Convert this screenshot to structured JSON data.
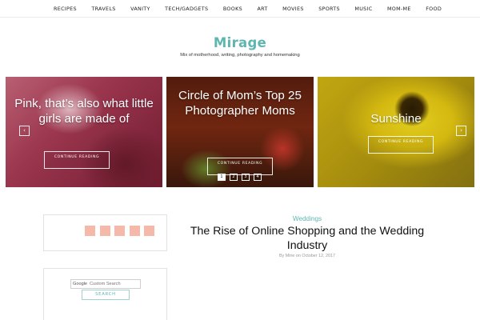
{
  "nav": {
    "items": [
      "RECIPES",
      "TRAVELS",
      "VANITY",
      "TECH/GADGETS",
      "BOOKS",
      "ART",
      "MOVIES",
      "SPORTS",
      "MUSIC",
      "MOM-ME",
      "FOOD"
    ]
  },
  "site": {
    "title": "Mirage",
    "tagline": "Mix of motherhood, writing, photography and homemaking"
  },
  "slider": {
    "slides": [
      {
        "title": "Pink, that’s also what little girls are made of",
        "button": "CONTINUE READING"
      },
      {
        "title": "Circle of Mom’s Top 25 Photographer Moms",
        "button": "CONTINUE READING"
      },
      {
        "title": "Sunshine",
        "button": "CONTINUE READING"
      }
    ],
    "prev_arrow": "‹",
    "next_arrow": "›",
    "pages": [
      "1",
      "2",
      "3",
      "4"
    ],
    "active_page": "1"
  },
  "sidebar": {
    "social_icon_count": 5,
    "social_color": "#f5b9aa",
    "search": {
      "google_label": "Google",
      "placeholder": "Custom Search",
      "button": "SEARCH"
    }
  },
  "post": {
    "category": "Weddings",
    "title": "The Rise of Online Shopping and the Wedding Industry",
    "meta": "By Mirie on October 12, 2017"
  },
  "colors": {
    "accent": "#5fb5b0",
    "social": "#f5b9aa"
  }
}
